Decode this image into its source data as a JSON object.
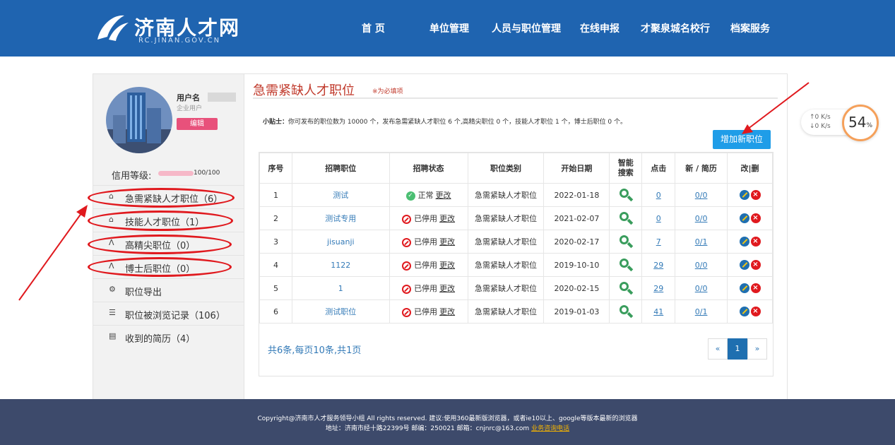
{
  "header": {
    "logo_title": "济南人才网",
    "logo_sub": "RC.JINAN.GOV.CN",
    "nav": [
      "首 页",
      "单位管理",
      "人员与职位管理",
      "在线申报",
      "才聚泉城名校行",
      "档案服务"
    ]
  },
  "sidebar": {
    "username_label": "用户名",
    "user_type": "企业用户",
    "edit_label": "编辑",
    "credit_label": "信用等级:",
    "credit_value": "100/100",
    "credit_level": 1.0,
    "menu": [
      {
        "label": "急需紧缺人才职位（6）",
        "icon": "home-icon"
      },
      {
        "label": "技能人才职位（1）",
        "icon": "home-icon"
      },
      {
        "label": "高精尖职位（0）",
        "icon": "road-icon"
      },
      {
        "label": "博士后职位（0）",
        "icon": "road-icon"
      },
      {
        "label": "职位导出",
        "icon": "gear-icon"
      },
      {
        "label": "职位被浏览记录（106）",
        "icon": "list-icon"
      },
      {
        "label": "收到的简历（4）",
        "icon": "document-icon"
      }
    ]
  },
  "content": {
    "title": "急需紧缺人才职位",
    "required_note": "※为必填项",
    "tip_label": "小贴士：",
    "tip_text": "你可发布的职位数为  10000  个，发布急需紧缺人才职位  6  个,高精尖职位  0  个，技能人才职位  1  个，博士后职位  0  个。",
    "add_button": "增加新职位",
    "table": {
      "headers": [
        "序号",
        "招聘职位",
        "招聘状态",
        "职位类别",
        "开始日期",
        "智能搜索",
        "点击",
        "新 / 简历",
        "改|删"
      ],
      "rows": [
        {
          "no": "1",
          "position": "测试",
          "status": "正常",
          "status_type": "ok",
          "change": "更改",
          "category": "急需紧缺人才职位",
          "date": "2022-01-18",
          "clicks": "0",
          "resume": "0/0"
        },
        {
          "no": "2",
          "position": "测试专用",
          "status": "已停用",
          "status_type": "off",
          "change": "更改",
          "category": "急需紧缺人才职位",
          "date": "2021-02-07",
          "clicks": "0",
          "resume": "0/0"
        },
        {
          "no": "3",
          "position": "jisuanji",
          "status": "已停用",
          "status_type": "off",
          "change": "更改",
          "category": "急需紧缺人才职位",
          "date": "2020-02-17",
          "clicks": "7",
          "resume": "0/1"
        },
        {
          "no": "4",
          "position": "1122",
          "status": "已停用",
          "status_type": "off",
          "change": "更改",
          "category": "急需紧缺人才职位",
          "date": "2019-10-10",
          "clicks": "29",
          "resume": "0/0"
        },
        {
          "no": "5",
          "position": "1",
          "status": "已停用",
          "status_type": "off",
          "change": "更改",
          "category": "急需紧缺人才职位",
          "date": "2020-02-15",
          "clicks": "29",
          "resume": "0/0"
        },
        {
          "no": "6",
          "position": "测试职位",
          "status": "已停用",
          "status_type": "off",
          "change": "更改",
          "category": "急需紧缺人才职位",
          "date": "2019-01-03",
          "clicks": "41",
          "resume": "0/1"
        }
      ]
    },
    "summary": "共6条,每页10条,共1页",
    "pager": {
      "prev": "«",
      "current": "1",
      "next": "»"
    }
  },
  "speed_widget": {
    "up": "↑0  K/s",
    "down": "↓0  K/s",
    "percent": "54",
    "percent_unit": "%"
  },
  "footer": {
    "line1": "Copyright@济南市人才服务领导小组 All rights reserved. 建议:使用360最新版浏览器，或者ie10以上、google等版本最新的浏览器",
    "line2_prefix": "地址：济南市经十路22399号 邮编：250021 邮箱：cnjnrc@163.com ",
    "line2_link": "业务咨询电话"
  },
  "colors": {
    "header_bg": "#1f64b0",
    "title_red": "#c0392b",
    "annotation_red": "#e0191e",
    "link_blue": "#337ab7",
    "footer_bg": "#3d4a6b"
  }
}
